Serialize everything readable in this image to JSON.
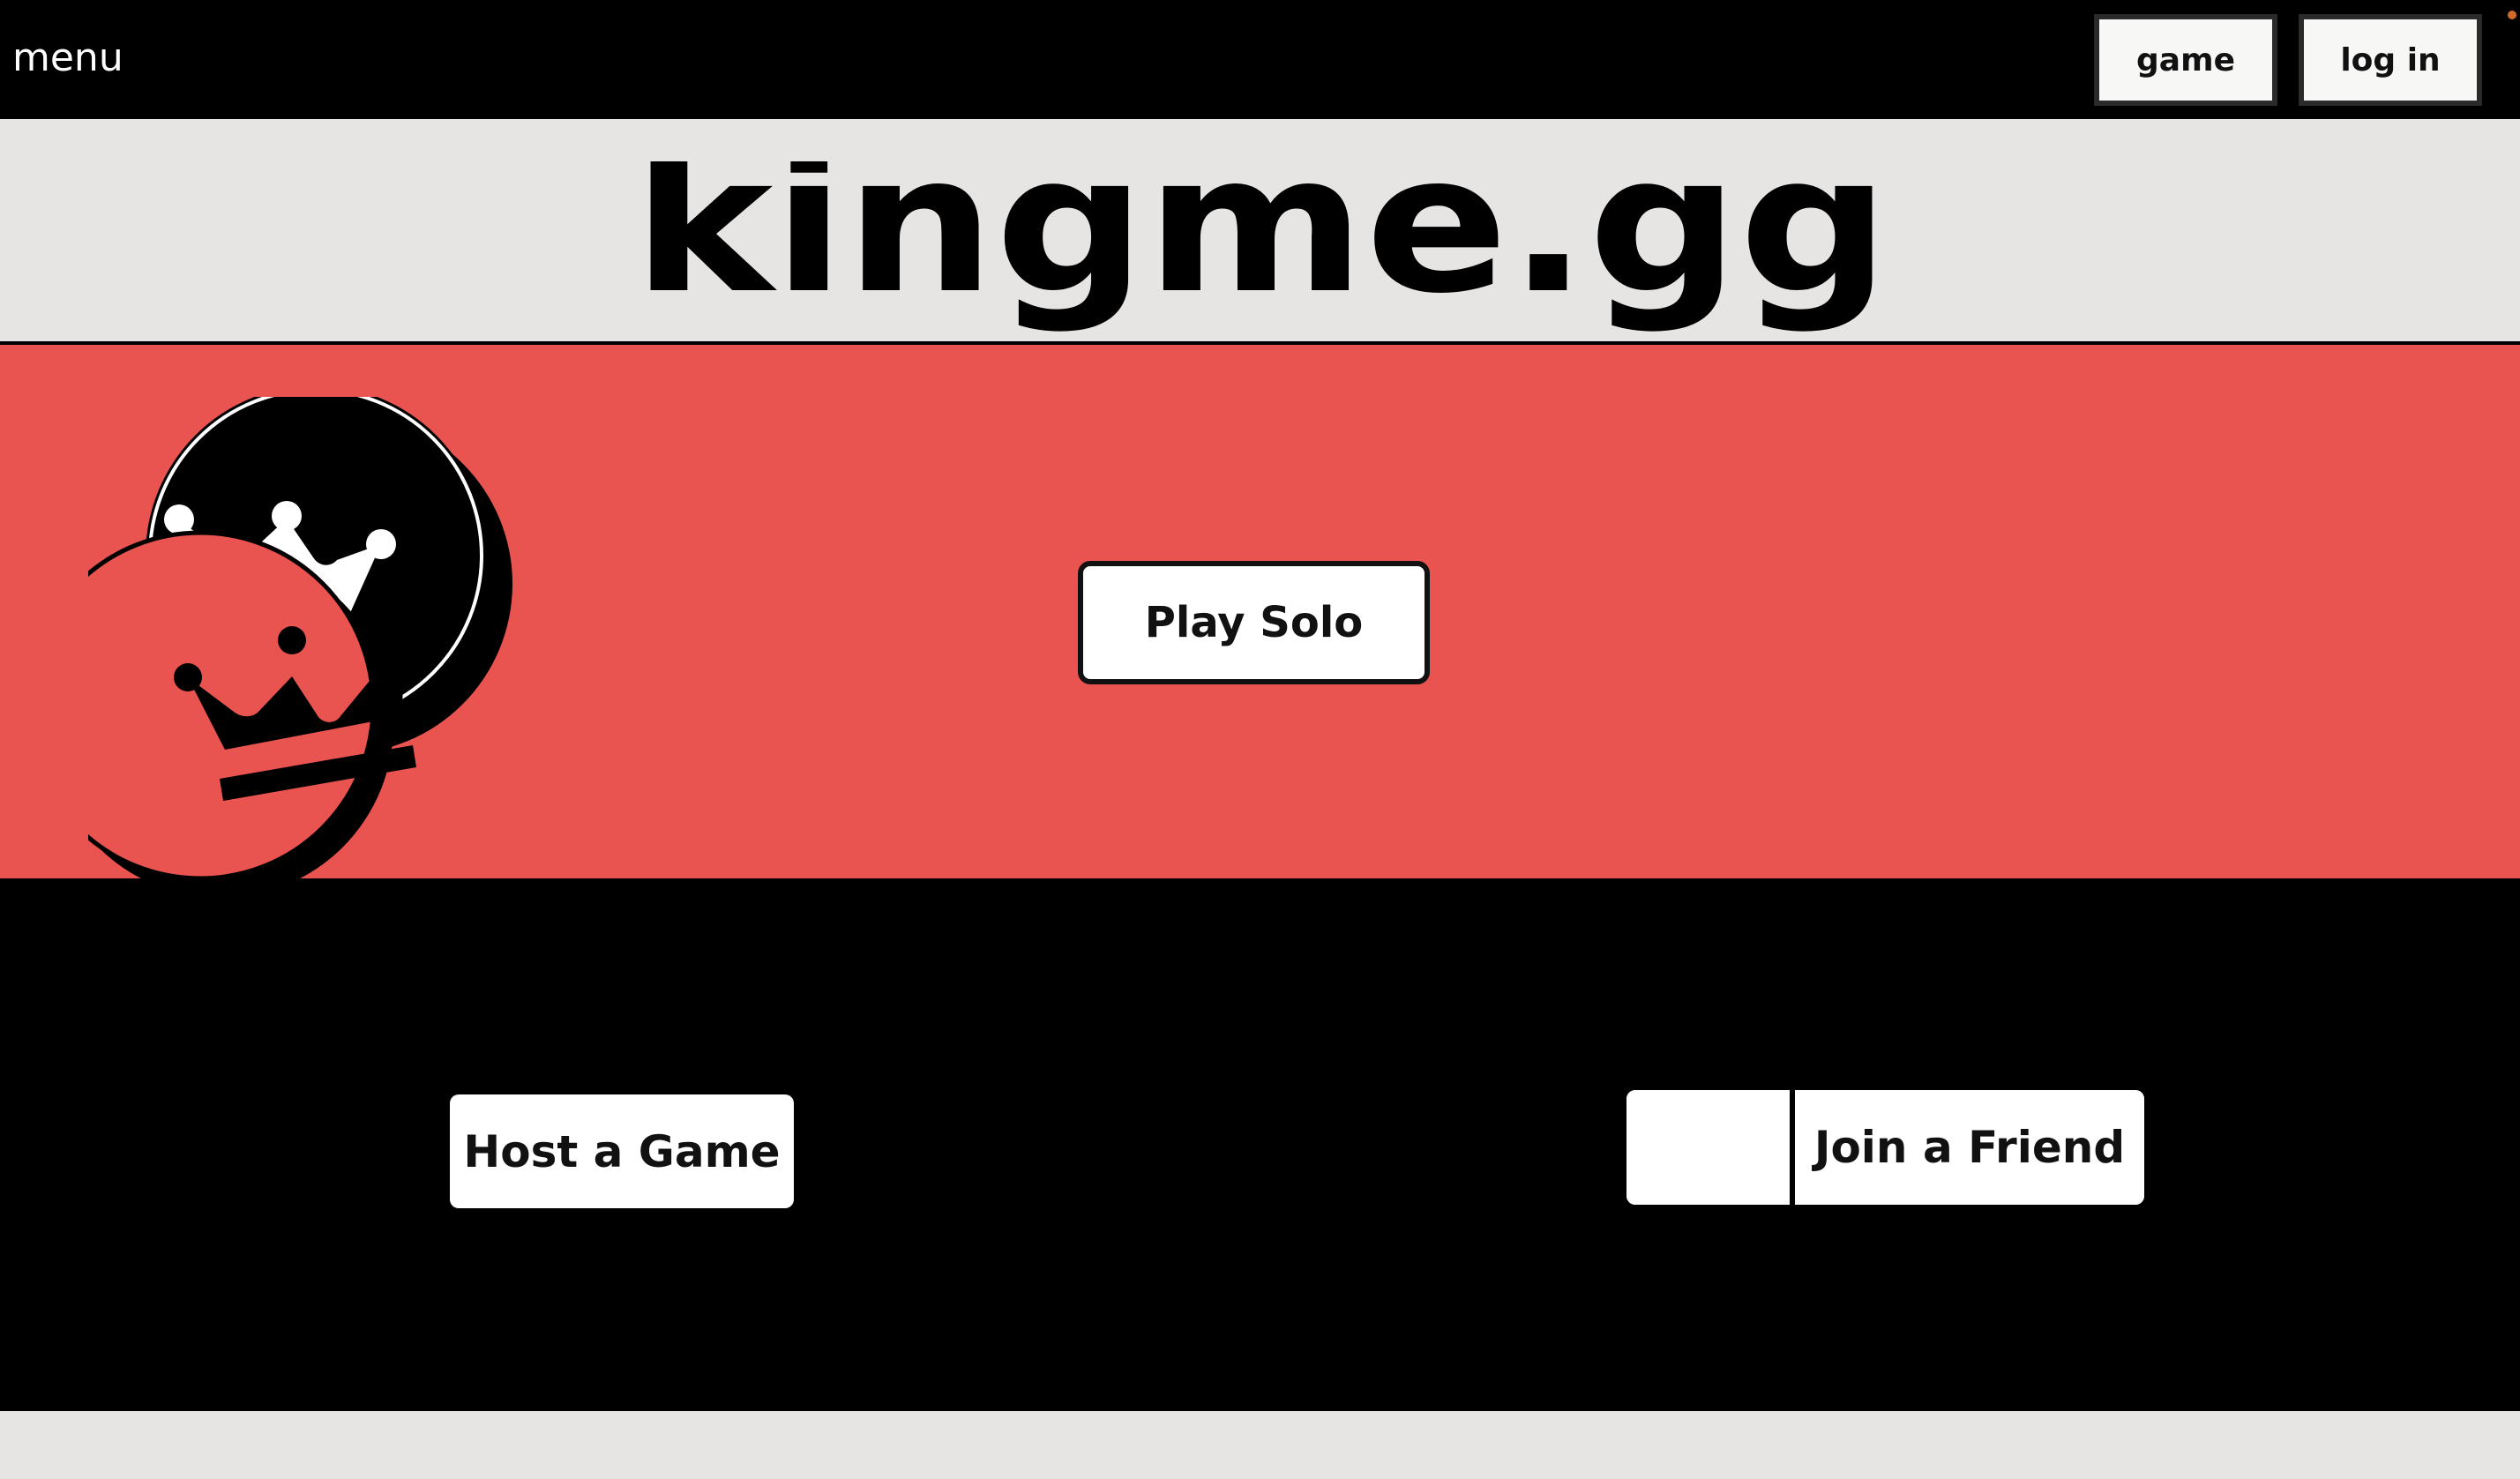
{
  "topbar": {
    "menu_label": "menu",
    "game_button": "game",
    "login_button": "log in"
  },
  "header": {
    "logo_text": "kingme.gg"
  },
  "hero": {
    "play_solo_label": "Play Solo",
    "pieces": [
      {
        "icon": "crown-icon",
        "color": "#000000"
      },
      {
        "icon": "crown-icon",
        "color": "#ea5450"
      }
    ]
  },
  "actions": {
    "host_label": "Host a Game",
    "join_label": "Join a Friend",
    "join_code_value": "",
    "join_code_placeholder": ""
  },
  "colors": {
    "red": "#ea5450",
    "black": "#000000",
    "light": "#e6e5e3",
    "white": "#ffffff"
  }
}
